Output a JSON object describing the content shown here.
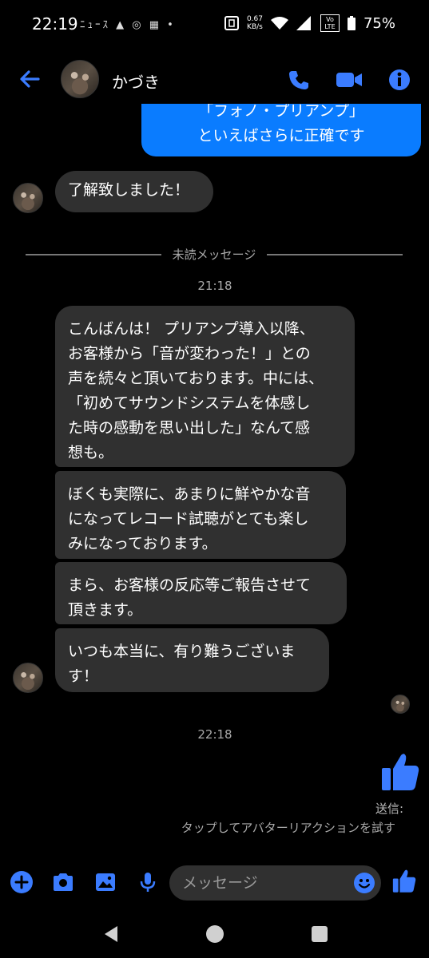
{
  "status_bar": {
    "time": "22:19",
    "notif_icons": "ﾆｭｰｽ ▲ ◎ ▦ •",
    "speed_value": "0.67",
    "speed_unit": "KB/s",
    "volte": "Vo LTE",
    "battery": "75%"
  },
  "header": {
    "contact_name": "かづき"
  },
  "messages": {
    "sent_prev": {
      "line1": "「フォノ・プリアンプ」",
      "line2": "といえばさらに正確です"
    },
    "ack": "了解致しました！",
    "unread_divider": "未読メッセージ",
    "timestamp1": "21:18",
    "incoming": [
      {
        "lines": [
          "こんばんは！ プリアンプ導入以降、",
          "お客様から「音が変わった！」との",
          "声を続々と頂いております。中には、",
          "「初めてサウンドシステムを体感し",
          "た時の感動を思い出した」なんて感",
          "想も。"
        ]
      },
      {
        "lines": [
          "ぼくも実際に、あまりに鮮やかな音",
          "になってレコード試聴がとても楽し",
          "みになっております。"
        ]
      },
      {
        "lines": [
          "まら、お客様の反応等ご報告させて",
          "頂きます。"
        ]
      },
      {
        "lines": [
          "いつも本当に、有り難うございま",
          "す！"
        ]
      }
    ],
    "timestamp2": "22:18",
    "sent_status": "送信:",
    "avatar_reaction_hint": "タップしてアバターリアクションを試す"
  },
  "composer": {
    "placeholder": "メッセージ"
  },
  "colors": {
    "accent": "#3b7cff",
    "outgoing_bubble": "#0a7cff",
    "incoming_bubble": "#303030",
    "background": "#000000"
  }
}
